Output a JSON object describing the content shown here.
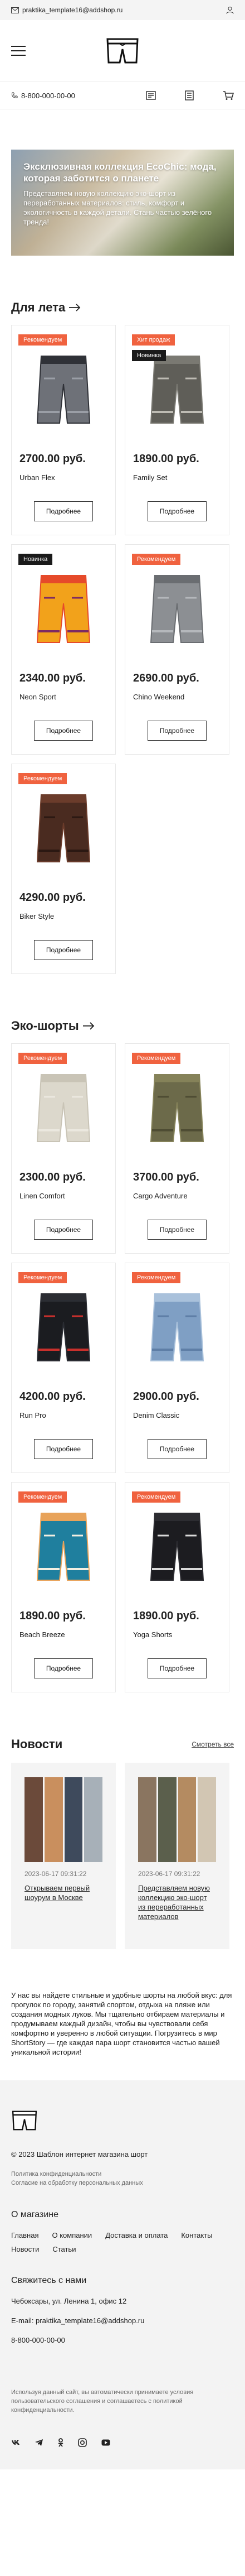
{
  "topbar": {
    "email": "praktika_template16@addshop.ru"
  },
  "nav": {
    "phone": "8-800-000-00-00"
  },
  "hero": {
    "title": "Эксклюзивная коллекция EcoChic: мода, которая заботится о планете",
    "text": "Представляем новую коллекцию эко-шорт из переработанных материалов: стиль, комфорт и экологичность в каждой детали. Стань частью зелёного тренда!"
  },
  "sections": [
    {
      "title": "Для лета",
      "products": [
        {
          "badges": [
            "Рекомендуем"
          ],
          "price": "2700.00 руб.",
          "name": "Urban Flex",
          "colors": [
            "#6e7178",
            "#2f3137",
            "#9a9ea6"
          ]
        },
        {
          "badges": [
            "Хит продаж",
            "Новинка"
          ],
          "price": "1890.00 руб.",
          "name": "Family Set",
          "colors": [
            "#5f5e58",
            "#7a7972",
            "#bdbbb3"
          ]
        },
        {
          "badges": [
            "Новинка"
          ],
          "price": "2340.00 руб.",
          "name": "Neon Sport",
          "colors": [
            "#f2a21b",
            "#e64a2a",
            "#7d2a63"
          ]
        },
        {
          "badges": [
            "Рекомендуем"
          ],
          "price": "2690.00 руб.",
          "name": "Chino Weekend",
          "colors": [
            "#8c8f93",
            "#6a6d71",
            "#b5b8bc"
          ]
        },
        {
          "badges": [
            "Рекомендуем"
          ],
          "price": "4290.00 руб.",
          "name": "Biker Style",
          "colors": [
            "#4a2b20",
            "#6b3c2b",
            "#2b1812"
          ]
        }
      ]
    },
    {
      "title": "Эко-шорты",
      "products": [
        {
          "badges": [
            "Рекомендуем"
          ],
          "price": "2300.00 руб.",
          "name": "Linen Comfort",
          "colors": [
            "#dcd8cc",
            "#c9c4b6",
            "#ebe8df"
          ]
        },
        {
          "badges": [
            "Рекомендуем"
          ],
          "price": "3700.00 руб.",
          "name": "Cargo Adventure",
          "colors": [
            "#6c6a4a",
            "#858259",
            "#4e4c33"
          ]
        },
        {
          "badges": [
            "Рекомендуем"
          ],
          "price": "4200.00 руб.",
          "name": "Run Pro",
          "colors": [
            "#1b1c20",
            "#2b2d33",
            "#c9302c"
          ]
        },
        {
          "badges": [
            "Рекомендуем"
          ],
          "price": "2900.00 руб.",
          "name": "Denim Classic",
          "colors": [
            "#7f9fc4",
            "#a9c1db",
            "#5e7ea6"
          ]
        },
        {
          "badges": [
            "Рекомендуем"
          ],
          "price": "1890.00 руб.",
          "name": "Beach Breeze",
          "colors": [
            "#1f7f9e",
            "#e8a35a",
            "#f3efe2"
          ]
        },
        {
          "badges": [
            "Рекомендуем"
          ],
          "price": "1890.00 руб.",
          "name": "Yoga Shorts",
          "colors": [
            "#1c1c20",
            "#2c2c31",
            "#d9d9d9"
          ]
        }
      ]
    }
  ],
  "more_label": "Подробнее",
  "news": {
    "title": "Новости",
    "all": "Смотреть все",
    "items": [
      {
        "date": "2023-06-17 09:31:22",
        "title": "Открываем первый шоурум в Москве",
        "colors": [
          "#6b4a3a",
          "#c98f5e",
          "#3e4a5c",
          "#a7b0b8"
        ]
      },
      {
        "date": "2023-06-17 09:31:22",
        "title": "Представляем новую коллекцию эко-шорт из переработанных материалов",
        "colors": [
          "#8a7560",
          "#5b5f4c",
          "#b48b61",
          "#d2c6b3"
        ]
      }
    ]
  },
  "about": "У нас вы найдете стильные и удобные шорты на любой вкус: для прогулок по городу, занятий спортом, отдыха на пляже или создания модных луков. Мы тщательно отбираем материалы и продумываем каждый дизайн, чтобы вы чувствовали себя комфортно и уверенно в любой ситуации. Погрузитесь в мир ShortStory — где каждая пара шорт становится частью вашей уникальной истории!",
  "footer": {
    "copyright": "© 2023 Шаблон интернет магазина шорт",
    "policy1": "Политика конфиденциальности",
    "policy2": "Согласие на обработку персональных данных",
    "about_title": "О магазине",
    "links": [
      "Главная",
      "О компании",
      "Доставка и оплата",
      "Контакты",
      "Новости",
      "Статьи"
    ],
    "contact_title": "Свяжитесь с нами",
    "address": "Чебоксары, ул. Ленина 1, офис 12",
    "email": "E-mail: praktika_template16@addshop.ru",
    "phone": "8-800-000-00-00",
    "disclaimer": "Используя данный сайт, вы автоматически принимаете условия пользовательского соглашения и соглашаетесь с политикой конфиденциальности.",
    "social": [
      "vk-icon",
      "telegram-icon",
      "odnoklassniki-icon",
      "youtube-icon",
      "rutube-icon"
    ]
  }
}
